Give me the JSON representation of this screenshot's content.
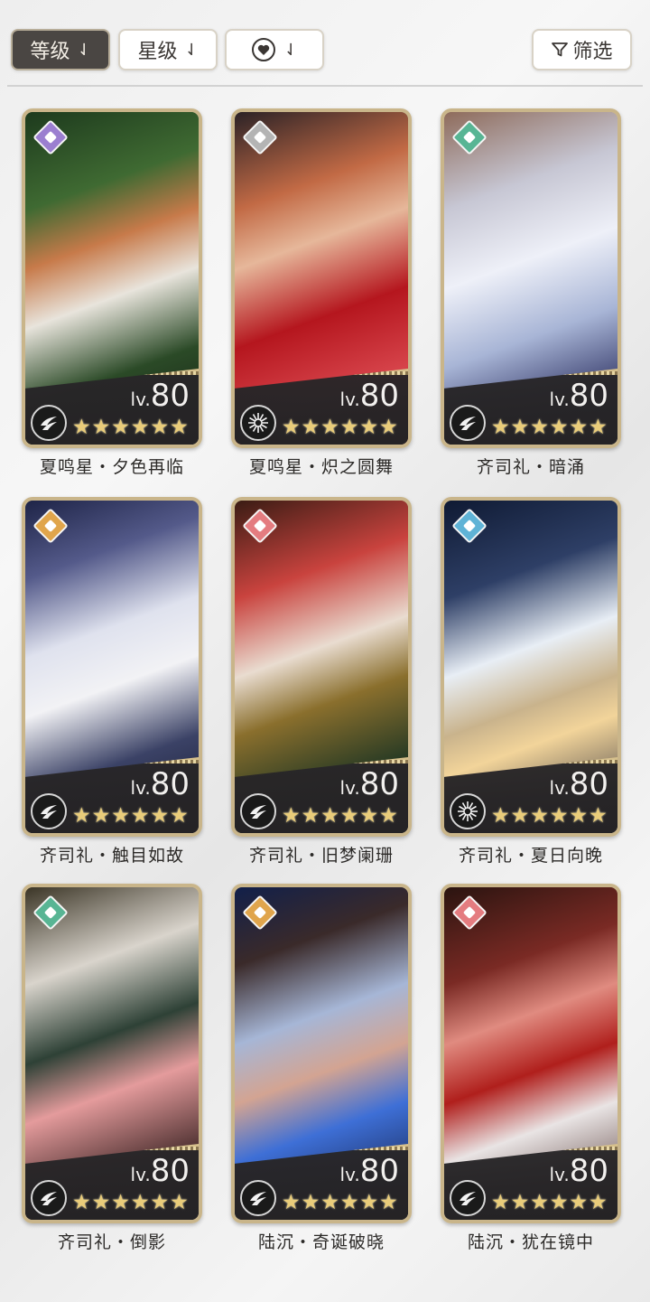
{
  "toolbar": {
    "sort_level_label": "等级",
    "sort_star_label": "星级",
    "sort_arrow": "⇃",
    "filter_label": "筛选",
    "filter_icon": "funnel-icon",
    "affection_icon": "heart-icon"
  },
  "cards": [
    {
      "name": "夏鸣星・夕色再临",
      "level_prefix": "lv.",
      "level": "80",
      "stars": 6,
      "gem_color": "#9b7fd0",
      "type_icon": "claw-icon",
      "art": "linear-gradient(160deg,#1d3a1d 0%,#3f6a32 25%,#c77a4a 40%,#e8e4dc 55%,#2b4a27 75%,#111a10 100%)"
    },
    {
      "name": "夏鸣星・炽之圆舞",
      "level_prefix": "lv.",
      "level": "80",
      "stars": 6,
      "gem_color": "#b4b4b4",
      "type_icon": "burst-icon",
      "art": "linear-gradient(160deg,#2b2226 0%,#c26a45 25%,#e6b79a 40%,#b5161e 60%,#d6434a 80%,#7a1a18 100%)"
    },
    {
      "name": "齐司礼・暗涌",
      "level_prefix": "lv.",
      "level": "80",
      "stars": 6,
      "gem_color": "#58b594",
      "type_icon": "claw-icon",
      "art": "linear-gradient(160deg,#8e6b5b 0%,#c7c7d4 25%,#eef0f8 45%,#a8b5d6 65%,#3a3f6e 85%,#1b2040 100%)"
    },
    {
      "name": "齐司礼・触目如故",
      "level_prefix": "lv.",
      "level": "80",
      "stars": 6,
      "gem_color": "#e0a54c",
      "type_icon": "claw-icon",
      "art": "linear-gradient(160deg,#1e2447 0%,#545a8a 20%,#dfe2ee 40%,#f2f2f5 55%,#3b4266 75%,#11142a 100%)"
    },
    {
      "name": "齐司礼・旧梦阑珊",
      "level_prefix": "lv.",
      "level": "80",
      "stars": 6,
      "gem_color": "#e47c80",
      "type_icon": "claw-icon",
      "art": "linear-gradient(160deg,#3a1c14 0%,#c9433e 25%,#e9dcd0 45%,#8a6f2d 60%,#2b3c24 80%,#140f0c 100%)"
    },
    {
      "name": "齐司礼・夏日向晚",
      "level_prefix": "lv.",
      "level": "80",
      "stars": 6,
      "gem_color": "#5fb3d6",
      "type_icon": "burst-icon",
      "art": "linear-gradient(160deg,#0f1a33 0%,#2e3f66 25%,#e8eef5 45%,#c9b38c 60%,#f2d49a 70%,#1a1d30 100%)"
    },
    {
      "name": "齐司礼・倒影",
      "level_prefix": "lv.",
      "level": "80",
      "stars": 6,
      "gem_color": "#58b594",
      "type_icon": "claw-icon",
      "art": "linear-gradient(160deg,#3b3526 0%,#d9d4cc 25%,#2e4136 45%,#e49b9c 60%,#5b3a3a 80%,#1c1a16 100%)"
    },
    {
      "name": "陆沉・奇诞破晓",
      "level_prefix": "lv.",
      "level": "80",
      "stars": 6,
      "gem_color": "#e0a54c",
      "type_icon": "claw-icon",
      "art": "linear-gradient(160deg,#12204a 0%,#3a2a2a 20%,#a6b6d6 40%,#d3a492 55%,#3e6fd6 70%,#0b0f2a 100%)"
    },
    {
      "name": "陆沉・犹在镜中",
      "level_prefix": "lv.",
      "level": "80",
      "stars": 6,
      "gem_color": "#e47c80",
      "type_icon": "claw-icon",
      "art": "linear-gradient(160deg,#2a1410 0%,#7a2a24 25%,#e08b80 40%,#b01f1c 55%,#e9e4e4 70%,#3b1c18 100%)"
    }
  ]
}
